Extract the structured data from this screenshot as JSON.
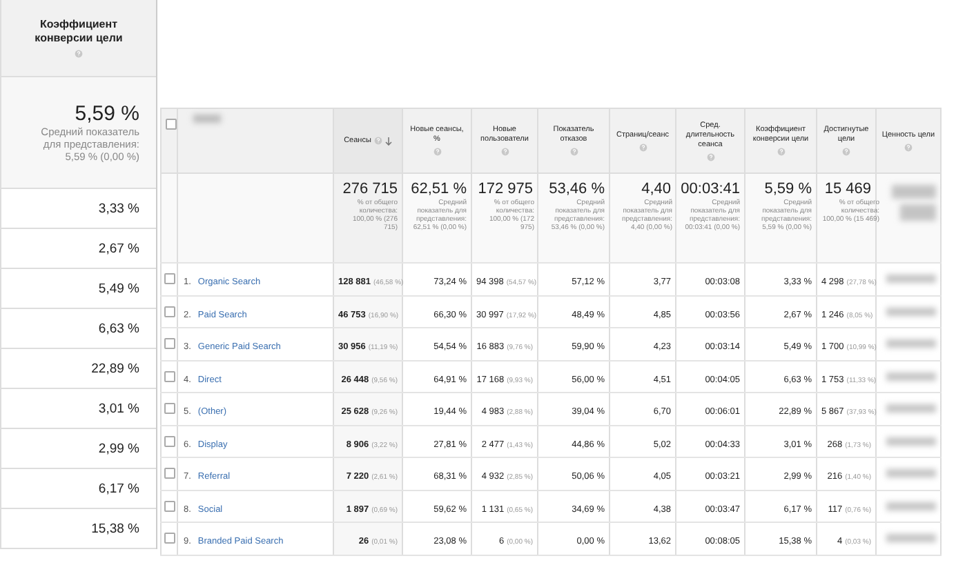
{
  "left_panel": {
    "header": "Коэффициент конверсии цели",
    "summary": {
      "value": "5,59 %",
      "note": "Средний показатель для представления: 5,59 % (0,00 %)"
    },
    "rows": [
      "3,33 %",
      "2,67 %",
      "5,49 %",
      "6,63 %",
      "22,89 %",
      "3,01 %",
      "2,99 %",
      "6,17 %",
      "15,38 %"
    ]
  },
  "table": {
    "select_all": {
      "checked": false
    },
    "columns": [
      {
        "label": "Сеансы",
        "sorted": true
      },
      {
        "label": "Новые сеансы, %",
        "sorted": false
      },
      {
        "label": "Новые пользователи",
        "sorted": false
      },
      {
        "label": "Показатель отказов",
        "sorted": false
      },
      {
        "label": "Страниц/сеанс",
        "sorted": false
      },
      {
        "label": "Сред. длительность сеанса",
        "sorted": false
      },
      {
        "label": "Коэффициент конверсии цели",
        "sorted": false
      },
      {
        "label": "Достигнутые цели",
        "sorted": false
      },
      {
        "label": "Ценность цели",
        "sorted": false
      }
    ],
    "summary": [
      {
        "value": "276 715",
        "note": "% от общего количества: 100,00 % (276 715)"
      },
      {
        "value": "62,51 %",
        "note": "Средний показатель для представления: 62,51 % (0,00 %)"
      },
      {
        "value": "172 975",
        "note": "% от общего количества: 100,00 % (172 975)"
      },
      {
        "value": "53,46 %",
        "note": "Средний показатель для представления: 53,46 % (0,00 %)"
      },
      {
        "value": "4,40",
        "note": "Средний показатель для представления: 4,40 (0,00 %)"
      },
      {
        "value": "00:03:41",
        "note": "Средний показатель для представления: 00:03:41 (0,00 %)"
      },
      {
        "value": "5,59 %",
        "note": "Средний показатель для представления: 5,59 % (0,00 %)"
      },
      {
        "value": "15 469",
        "note": "% от общего количества: 100,00 % (15 469)"
      }
    ],
    "rows": [
      {
        "number": "1.",
        "name": "Organic Search",
        "checked": false,
        "cells": [
          {
            "value": "128 881",
            "share": "(46,58 %)"
          },
          {
            "value": "73,24 %"
          },
          {
            "value": "94 398",
            "share": "(54,57 %)"
          },
          {
            "value": "57,12 %"
          },
          {
            "value": "3,77"
          },
          {
            "value": "00:03:08"
          },
          {
            "value": "3,33 %"
          },
          {
            "value": "4 298",
            "share": "(27,78 %)"
          }
        ]
      },
      {
        "number": "2.",
        "name": "Paid Search",
        "checked": false,
        "cells": [
          {
            "value": "46 753",
            "share": "(16,90 %)"
          },
          {
            "value": "66,30 %"
          },
          {
            "value": "30 997",
            "share": "(17,92 %)"
          },
          {
            "value": "48,49 %"
          },
          {
            "value": "4,85"
          },
          {
            "value": "00:03:56"
          },
          {
            "value": "2,67 %"
          },
          {
            "value": "1 246",
            "share": "(8,05 %)"
          }
        ]
      },
      {
        "number": "3.",
        "name": "Generic Paid Search",
        "checked": false,
        "cells": [
          {
            "value": "30 956",
            "share": "(11,19 %)"
          },
          {
            "value": "54,54 %"
          },
          {
            "value": "16 883",
            "share": "(9,76 %)"
          },
          {
            "value": "59,90 %"
          },
          {
            "value": "4,23"
          },
          {
            "value": "00:03:14"
          },
          {
            "value": "5,49 %"
          },
          {
            "value": "1 700",
            "share": "(10,99 %)"
          }
        ]
      },
      {
        "number": "4.",
        "name": "Direct",
        "checked": false,
        "cells": [
          {
            "value": "26 448",
            "share": "(9,56 %)"
          },
          {
            "value": "64,91 %"
          },
          {
            "value": "17 168",
            "share": "(9,93 %)"
          },
          {
            "value": "56,00 %"
          },
          {
            "value": "4,51"
          },
          {
            "value": "00:04:05"
          },
          {
            "value": "6,63 %"
          },
          {
            "value": "1 753",
            "share": "(11,33 %)"
          }
        ]
      },
      {
        "number": "5.",
        "name": "(Other)",
        "checked": false,
        "cells": [
          {
            "value": "25 628",
            "share": "(9,26 %)"
          },
          {
            "value": "19,44 %"
          },
          {
            "value": "4 983",
            "share": "(2,88 %)"
          },
          {
            "value": "39,04 %"
          },
          {
            "value": "6,70"
          },
          {
            "value": "00:06:01"
          },
          {
            "value": "22,89 %"
          },
          {
            "value": "5 867",
            "share": "(37,93 %)"
          }
        ]
      },
      {
        "number": "6.",
        "name": "Display",
        "checked": false,
        "cells": [
          {
            "value": "8 906",
            "share": "(3,22 %)"
          },
          {
            "value": "27,81 %"
          },
          {
            "value": "2 477",
            "share": "(1,43 %)"
          },
          {
            "value": "44,86 %"
          },
          {
            "value": "5,02"
          },
          {
            "value": "00:04:33"
          },
          {
            "value": "3,01 %"
          },
          {
            "value": "268",
            "share": "(1,73 %)"
          }
        ]
      },
      {
        "number": "7.",
        "name": "Referral",
        "checked": false,
        "cells": [
          {
            "value": "7 220",
            "share": "(2,61 %)"
          },
          {
            "value": "68,31 %"
          },
          {
            "value": "4 932",
            "share": "(2,85 %)"
          },
          {
            "value": "50,06 %"
          },
          {
            "value": "4,05"
          },
          {
            "value": "00:03:21"
          },
          {
            "value": "2,99 %"
          },
          {
            "value": "216",
            "share": "(1,40 %)"
          }
        ]
      },
      {
        "number": "8.",
        "name": "Social",
        "checked": false,
        "cells": [
          {
            "value": "1 897",
            "share": "(0,69 %)"
          },
          {
            "value": "59,62 %"
          },
          {
            "value": "1 131",
            "share": "(0,65 %)"
          },
          {
            "value": "34,69 %"
          },
          {
            "value": "4,38"
          },
          {
            "value": "00:03:47"
          },
          {
            "value": "6,17 %"
          },
          {
            "value": "117",
            "share": "(0,76 %)"
          }
        ]
      },
      {
        "number": "9.",
        "name": "Branded Paid Search",
        "checked": false,
        "cells": [
          {
            "value": "26",
            "share": "(0,01 %)"
          },
          {
            "value": "23,08 %"
          },
          {
            "value": "6",
            "share": "(0,00 %)"
          },
          {
            "value": "0,00 %"
          },
          {
            "value": "13,62"
          },
          {
            "value": "00:08:05"
          },
          {
            "value": "15,38 %"
          },
          {
            "value": "4",
            "share": "(0,03 %)"
          }
        ]
      }
    ]
  }
}
